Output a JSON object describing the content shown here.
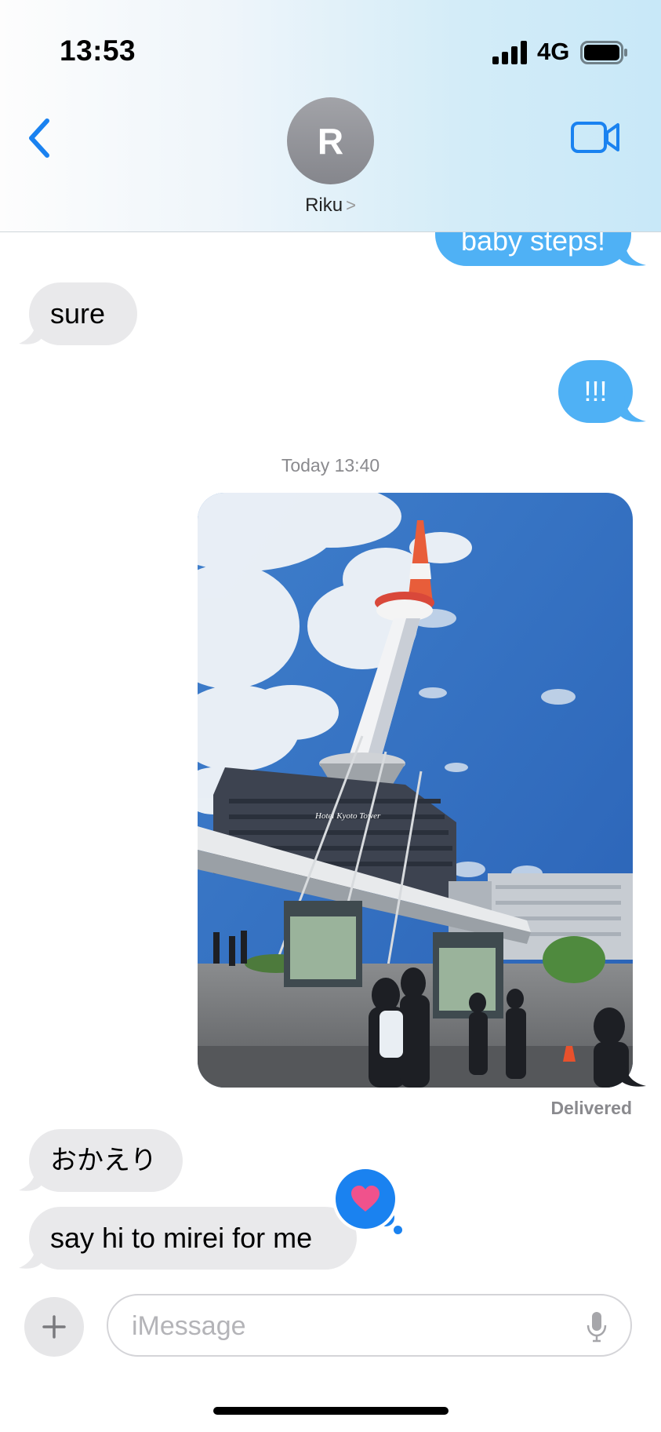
{
  "status_bar": {
    "time": "13:53",
    "network": "4G"
  },
  "header": {
    "avatar_initial": "R",
    "contact_name": "Riku",
    "contact_chevron": ">"
  },
  "messages": [
    {
      "type": "outgoing",
      "text": "baby steps!"
    },
    {
      "type": "incoming",
      "text": "sure"
    },
    {
      "type": "outgoing",
      "text": "!!!"
    },
    {
      "type": "timestamp",
      "text": "Today 13:40"
    },
    {
      "type": "outgoing-photo",
      "photo_sign_text": "Hotel Kyoto Tower"
    },
    {
      "type": "status",
      "text": "Delivered"
    },
    {
      "type": "incoming",
      "text": "おかえり"
    },
    {
      "type": "incoming",
      "text": "say hi to mirei for me",
      "reaction": "heart"
    }
  ],
  "composer": {
    "placeholder": "iMessage"
  },
  "icons": {
    "back": "chevron-left-icon",
    "video": "video-camera-icon",
    "plus": "plus-icon",
    "mic": "microphone-icon",
    "reaction": "heart-icon"
  },
  "colors": {
    "accent": "#1a82f0",
    "outgoing_bubble": "#4fb1f5",
    "incoming_bubble": "#e9e9eb",
    "heart": "#f0528c"
  }
}
